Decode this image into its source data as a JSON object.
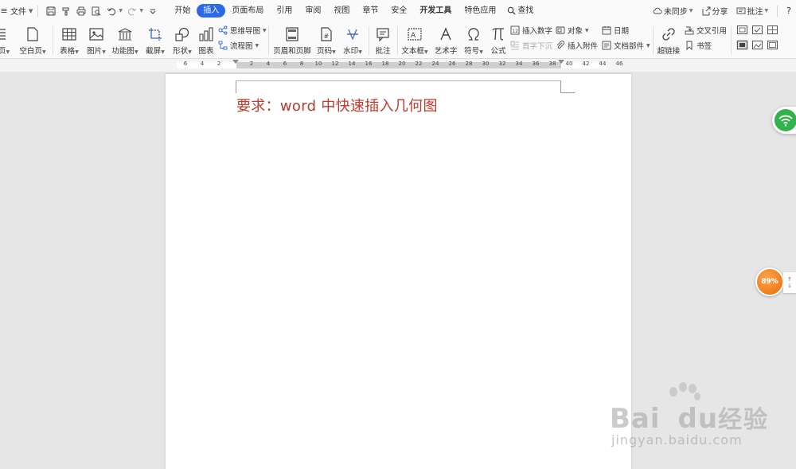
{
  "file_menu": {
    "label": "文件"
  },
  "tabs": [
    {
      "label": "开始"
    },
    {
      "label": "插入"
    },
    {
      "label": "页面布局"
    },
    {
      "label": "引用"
    },
    {
      "label": "审阅"
    },
    {
      "label": "视图"
    },
    {
      "label": "章节"
    },
    {
      "label": "安全"
    },
    {
      "label": "开发工具"
    },
    {
      "label": "特色应用"
    }
  ],
  "search": {
    "label": "查找"
  },
  "right_tools": {
    "sync": "未同步",
    "share": "分享",
    "comment": "批注",
    "help": "?"
  },
  "ribbon": {
    "cover_page": "页",
    "blank_page": "空白页",
    "table": "表格",
    "picture": "图片",
    "function_chart": "功能图",
    "screenshot": "截屏",
    "shape": "形状",
    "chart": "图表",
    "mind_map": "思维导图",
    "flowchart": "流程图",
    "header_footer": "页眉和页脚",
    "page_number": "页码",
    "watermark": "水印",
    "comment": "批注",
    "textbox": "文本框",
    "wordart": "艺术字",
    "symbol": "符号",
    "formula": "公式",
    "insert_number": "插入数字",
    "drop_cap": "首字下沉",
    "object": "对象",
    "attachment": "插入附件",
    "date": "日期",
    "doc_parts": "文档部件",
    "hyperlink": "超链接",
    "cross_ref": "交叉引用",
    "bookmark": "书签"
  },
  "ruler": {
    "left_numbers": [
      "6",
      "4",
      "2"
    ],
    "right_numbers": [
      "2",
      "4",
      "6",
      "8",
      "10",
      "12",
      "14",
      "16",
      "18",
      "20",
      "22",
      "24",
      "26",
      "28",
      "30",
      "32",
      "34",
      "36",
      "38",
      "40",
      "42",
      "44",
      "46"
    ]
  },
  "document": {
    "text": "要求：word 中快速插入几何图"
  },
  "floaters": {
    "speed_percent": "89%",
    "up_arrow": "↑",
    "down_arrow": "↓"
  },
  "watermark": {
    "brand_a": "Bai",
    "brand_b": "du",
    "brand_cn": "经验",
    "url": "jingyan.baidu.com"
  },
  "colors": {
    "accent": "#2b69e6",
    "doc_text": "#c0392b",
    "wifi": "#2fb34a",
    "speed": "#f07c1c"
  }
}
